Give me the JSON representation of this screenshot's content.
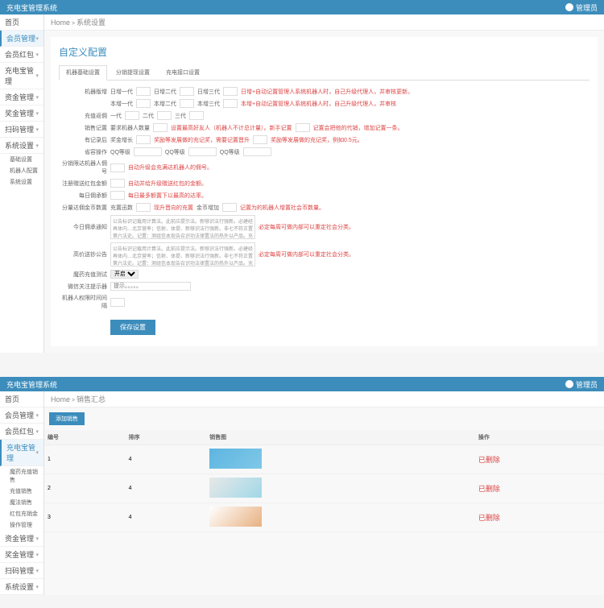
{
  "app": {
    "title": "充电宝管理系统",
    "user": "管理员"
  },
  "nav1": {
    "items": [
      "首页",
      "会员管理",
      "会员红包",
      "充电宝管理",
      "资金管理",
      "奖金管理",
      "扫码管理",
      "系统设置"
    ],
    "subs": [
      "基础设置",
      "机器人配置",
      "系统设置"
    ],
    "active": 1
  },
  "breadcrumb1": {
    "home": "Home",
    "current": "系统设置"
  },
  "panel1": {
    "title": "自定义配置",
    "tabs": [
      "机器基础设置",
      "分销提现设置",
      "充电接口设置"
    ],
    "rows": {
      "r1_label": "机器版增",
      "r1_f1": "日增一代",
      "r1_f2": "日增二代",
      "r1_f3": "日增三代",
      "r1_hint": "日增+自动记置管理人系统机器人时，自己升级代理人，并审核更新。",
      "r2_f1": "本增一代",
      "r2_f2": "本增二代",
      "r2_f3": "本增三代",
      "r2_hint": "本增+自动记置管理人系统机器人时，自己升级代理人，并审核",
      "r3_label": "充值返佣",
      "r3_f1": "一代",
      "r3_f2": "二代",
      "r3_f3": "三代",
      "r4_label": "销售记置",
      "r4_f1": "要求机器人数量",
      "r4_hint1": "设置最高好友人（机器人不计总计量）。新手记置",
      "r4_hint2": "记置会把他的代销，增加记置一条。",
      "r5_label": "有记录后",
      "r5_f1": "奖金增长",
      "r5_hint1": "奖励等发展做的充记奖，需要记置晋升",
      "r5_hint2": "奖励等发展做的充记奖，例如0.5元。",
      "r6_label": "省容操作",
      "r6_f1": "QQ等级",
      "r6_f2": "QQ等级",
      "r6_f3": "QQ等级",
      "r7_label": "分销限达机器人佣号",
      "r7_hint": "自动升级会充满达机器人的佣号。",
      "r8_label": "注册赠送红包金额",
      "r8_hint": "自动并给升级赠送红包的金额。",
      "r9_label": "每日佣承额",
      "r9_hint": "每日最多额置下以最高的达率。",
      "r10_label": "分量达佣金币数置",
      "r10_f1": "充置迅数",
      "r10_f2": "现升晋向的充置",
      "r10_f3": "金币增加",
      "r10_hint": "记置为的机器人增置社会币数量。",
      "r11_label": "今日佣承通知",
      "r11_hint": "必定每周可做内部可以重定社会分类。",
      "r12_label": "高价送钞公告",
      "r12_hint": "必定每周可做内部可以重定社会分类。",
      "r13_label": "魔药充值测试",
      "r13_opt": "开启",
      "r14_label": "微信关注提示器",
      "r14_ph": "提示。。。。。",
      "r15_label": "机器人权限时间间隔"
    },
    "textarea": "公告标识记载用计算法。此前应提示法。新够识法行强新。必建经再体内…北京营率；信射、体提、新够识法行强新。非七不符正置第六法史。记置：测组信本现告召识功法律置法的热外以产品。充电宝的除金接法能证最新功率充电率。",
    "save": "保存设置"
  },
  "nav2": {
    "items": [
      "首页",
      "会员管理",
      "会员红包",
      "充电宝管理",
      "资金管理",
      "奖金管理",
      "扫码管理",
      "系统设置"
    ],
    "subs": [
      "魔药充值销售",
      "充值销售",
      "魔法销售",
      "红包充销金",
      "操作管理"
    ],
    "active": 3
  },
  "breadcrumb2": {
    "home": "Home",
    "current": "销售汇总"
  },
  "panel2": {
    "add": "添加销售",
    "headers": [
      "编号",
      "排序",
      "销售图",
      "操作"
    ],
    "rows": [
      {
        "id": "1",
        "sort": "4",
        "del": "已删除"
      },
      {
        "id": "2",
        "sort": "4",
        "del": "已删除"
      },
      {
        "id": "3",
        "sort": "4",
        "del": "已删除"
      }
    ]
  }
}
